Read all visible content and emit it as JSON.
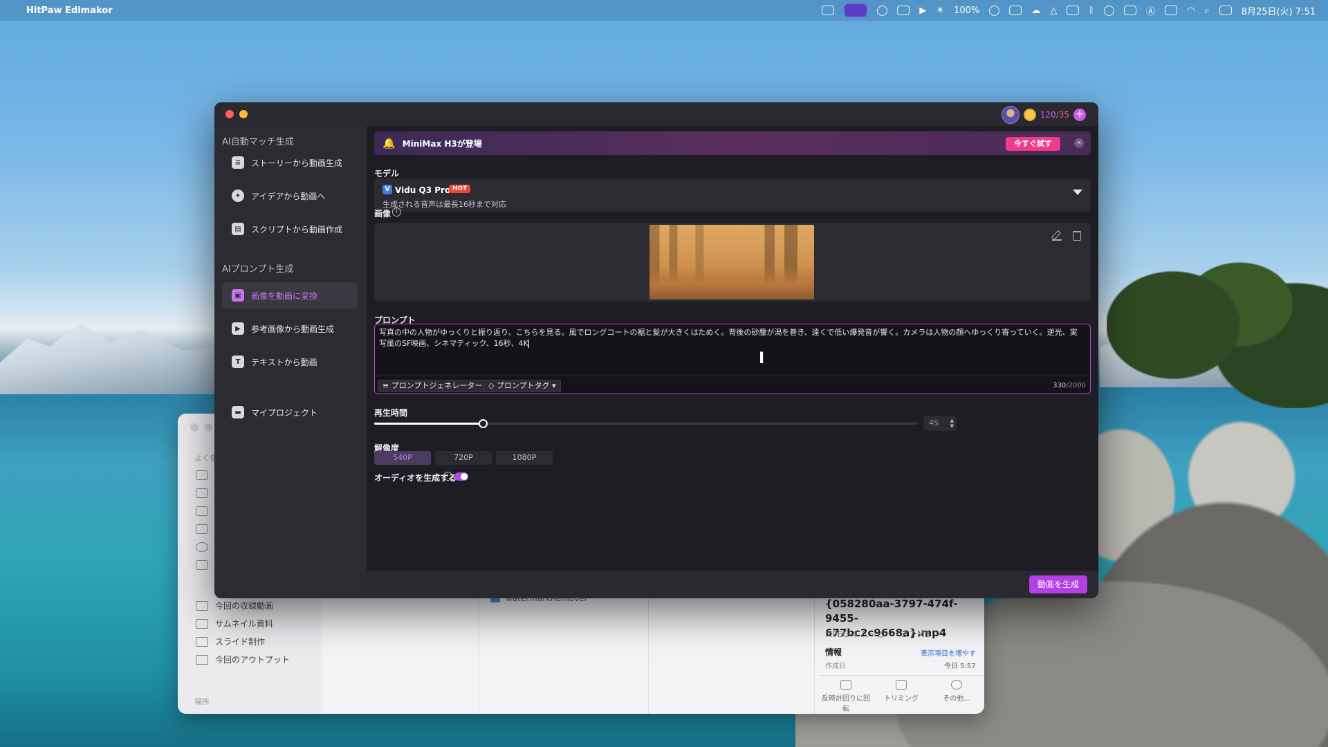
{
  "menubar": {
    "app_name": "HitPaw Edimakor",
    "brightness": "100%",
    "datetime": "8月25日(火) 7:51"
  },
  "finder": {
    "sidebar_label_favorites": "よく使",
    "items": [
      "今回の収録動画",
      "サムネイル資料",
      "スライド制作",
      "今回のアウトプット"
    ],
    "sidebar_label_places": "場所",
    "column_item": "watermarkRemover",
    "preview_filename": "{058280aa-3797-474f-9455-677bc2c9668a}.mp4",
    "preview_meta": "MPEG-4 ムービー - 2.7 MB",
    "info_label": "情報",
    "info_more": "表示項目を増やす",
    "created_label": "作成日",
    "created_value": "今日 5:57",
    "actions": [
      "反時計回りに回転",
      "トリミング",
      "その他..."
    ]
  },
  "account": {
    "credits_current": "120",
    "credits_total": "/35"
  },
  "sidebar": {
    "section1": "AI自動マッチ生成",
    "section1_items": [
      "ストーリーから動画生成",
      "アイデアから動画へ",
      "スクリプトから動画作成"
    ],
    "section2": "AIプロンプト生成",
    "section2_items": [
      "画像を動画に変換",
      "参考画像から動画生成",
      "テキストから動画"
    ],
    "my_projects": "マイプロジェクト"
  },
  "banner": {
    "text": "MiniMax H3が登場",
    "button": "今すぐ試す",
    "close": "×"
  },
  "model": {
    "label": "モデル",
    "name": "Vidu Q3 Pro",
    "badge": "HOT",
    "subtitle": "生成される音声は最長16秒まで対応"
  },
  "image": {
    "label": "画像"
  },
  "prompt": {
    "label": "プロンプト",
    "text": "写真の中の人物がゆっくりと振り返り、こちらを見る。風でロングコートの裾と髪が大きくはためく。背後の砂塵が渦を巻き、遠くで低い爆発音が響く。カメラは人物の顔へゆっくり寄っていく。逆光、実写風のSF映画、シネマティック、16秒、4K",
    "generator_button": "プロンプトジェネレーター",
    "tag_button": "プロンプトタグ",
    "count_current": "330",
    "count_max": "/2000"
  },
  "duration": {
    "label": "再生時間",
    "value": "4S",
    "slider_fraction": 0.2
  },
  "resolution": {
    "label": "解像度",
    "options": [
      "540P",
      "720P",
      "1080P"
    ],
    "selected": "540P"
  },
  "audio": {
    "label": "オーディオを生成する",
    "enabled": true
  },
  "footer": {
    "generate_button": "動画を生成"
  },
  "colors": {
    "accent": "#b548d8",
    "accent_text": "#c874ef",
    "banner_button": "#f03a8a",
    "hot_badge": "#f0463a"
  }
}
